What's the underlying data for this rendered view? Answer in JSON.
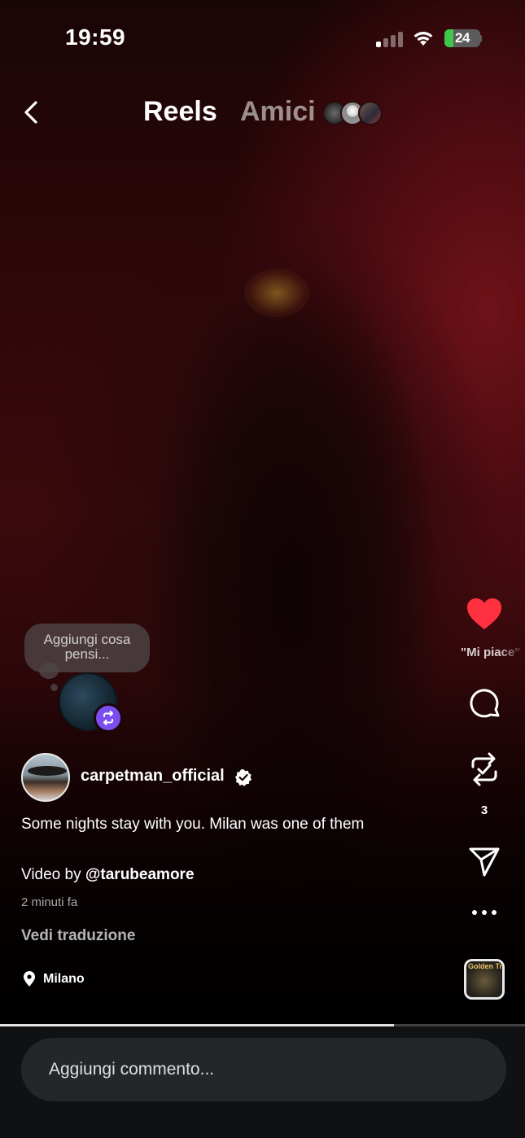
{
  "status_bar": {
    "time": "19:59",
    "battery": "24",
    "battery_level": 0.24,
    "battery_color": "#3ec74a"
  },
  "nav": {
    "back_icon": "chevron-left-icon",
    "tabs": [
      {
        "label": "Reels",
        "active": true
      },
      {
        "label": "Amici",
        "active": false
      }
    ]
  },
  "thought_bubble": {
    "text": "Aggiungi cosa pensi..."
  },
  "actions": {
    "like_icon": "heart-filled-icon",
    "like_color": "#ff3040",
    "like_label": "\"Mi piace\"",
    "comment_icon": "comment-icon",
    "repost_icon": "repost-icon",
    "repost_count": "3",
    "share_icon": "send-icon",
    "more_icon": "more-horizontal-icon"
  },
  "post": {
    "author": "carpetman_official",
    "verified": true,
    "caption": "Some nights stay with you. Milan was one of them",
    "credit_prefix": "Video by",
    "credit_handle": "@tarubeamore",
    "timestamp": "2 minuti fa",
    "translate": "Vedi traduzione",
    "location": "Milano"
  },
  "audio": {
    "cover_text": "Golden Trail"
  },
  "playback": {
    "progress": 0.75
  },
  "comment_bar": {
    "placeholder": "Aggiungi commento..."
  }
}
